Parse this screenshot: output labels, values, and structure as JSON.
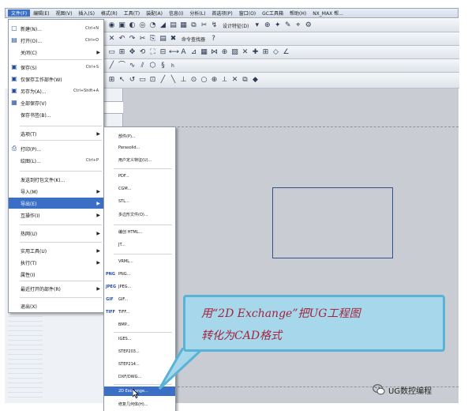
{
  "menubar": {
    "items": [
      "文件(F)",
      "编辑(E)",
      "视图(V)",
      "插入(S)",
      "格式(R)",
      "工具(T)",
      "装配(A)",
      "信息(I)",
      "分析(L)",
      "首选项(P)",
      "窗口(O)",
      "GC工具箱",
      "帮助(H)",
      "NX_MAX 帮..."
    ]
  },
  "toolbar": {
    "row1_text": "设计特征(D)",
    "row2_text": "命令查找器",
    "row3_text": "h"
  },
  "file_menu": {
    "items": [
      {
        "label": "新建(N)...",
        "shortcut": "Ctrl+N",
        "icon": "new-icon"
      },
      {
        "label": "打开(O)...",
        "shortcut": "Ctrl+O",
        "icon": "open-icon"
      },
      {
        "label": "关闭(C)",
        "arrow": "▶"
      },
      {
        "label": "保存(S)",
        "shortcut": "Ctrl+S",
        "icon": "save-icon"
      },
      {
        "label": "仅保存工作部件(W)",
        "icon": "save-work-icon"
      },
      {
        "label": "另存为(A)...",
        "shortcut": "Ctrl+Shift+A",
        "icon": "save-as-icon"
      },
      {
        "label": "全部保存(V)",
        "icon": "save-all-icon"
      },
      {
        "label": "保存书签(B)..."
      },
      {
        "label": "选项(T)",
        "arrow": "▶"
      },
      {
        "label": "打印(P)...",
        "icon": "print-icon"
      },
      {
        "label": "绘图(L)...",
        "shortcut": "Ctrl+P"
      },
      {
        "label": "发送到打包文件(K)..."
      },
      {
        "label": "导入(M)",
        "arrow": "▶"
      },
      {
        "label": "导出(E)",
        "arrow": "▶"
      },
      {
        "label": "互操作(I)",
        "arrow": "▶"
      },
      {
        "label": "热网(U)",
        "arrow": "▶"
      },
      {
        "label": "实用工具(U)",
        "arrow": "▶"
      },
      {
        "label": "执行(T)",
        "arrow": "▶"
      },
      {
        "label": "属性(I)"
      },
      {
        "label": "最近打开的部件(R)",
        "arrow": "▶"
      },
      {
        "label": "退出(X)"
      }
    ]
  },
  "export_submenu": {
    "items": [
      {
        "label": "部件(P)..."
      },
      {
        "label": "Parasolid..."
      },
      {
        "label": "用户定义特征(U)..."
      },
      {
        "label": "PDF..."
      },
      {
        "label": "CGM..."
      },
      {
        "label": "STL..."
      },
      {
        "label": "多边形文件(O)..."
      },
      {
        "label": "编创 HTML..."
      },
      {
        "label": "JT..."
      },
      {
        "label": "VRML..."
      },
      {
        "label": "PNG...",
        "icon": "PNG"
      },
      {
        "label": "JPEG...",
        "icon": "JPEG"
      },
      {
        "label": "GIF...",
        "icon": "GIF"
      },
      {
        "label": "TIFF...",
        "icon": "TIFF"
      },
      {
        "label": "BMP..."
      },
      {
        "label": "IGES..."
      },
      {
        "label": "STEP203..."
      },
      {
        "label": "STEP214..."
      },
      {
        "label": "DXF/DWG..."
      },
      {
        "label": "2D Exchange..."
      },
      {
        "label": "修复几何体(H)..."
      }
    ]
  },
  "callout": {
    "line1": "用“2D Exchange”把UG工程图",
    "line2": "转化为CAD格式"
  },
  "watermark": {
    "text": "UG数控编程"
  }
}
